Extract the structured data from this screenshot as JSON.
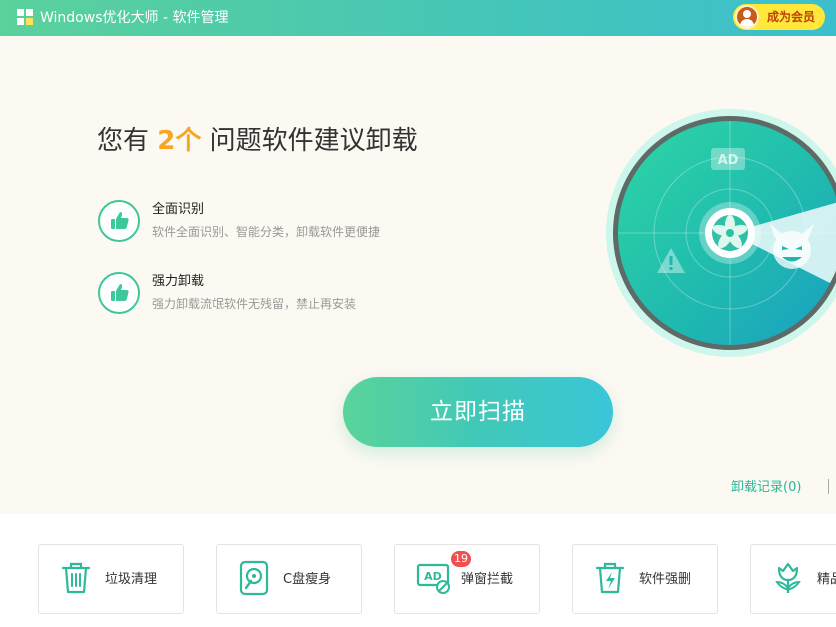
{
  "window": {
    "title": "Windows优化大师 - 软件管理"
  },
  "member_button": {
    "label": "成为会员"
  },
  "headline": {
    "prefix": "您有",
    "count": "2个",
    "suffix": "问题软件建议卸载"
  },
  "features": [
    {
      "title": "全面识别",
      "desc": "软件全面识别、智能分类，卸载软件更便捷",
      "icon": "thumbs-up-icon"
    },
    {
      "title": "强力卸载",
      "desc": "强力卸载流氓软件无残留，禁止再安装",
      "icon": "thumbs-up-icon"
    }
  ],
  "radar": {
    "ad_label": "AD"
  },
  "scan_button": {
    "label": "立即扫描"
  },
  "uninstall_history": {
    "label": "卸载记录(0)"
  },
  "tools": [
    {
      "label": "垃圾清理",
      "icon": "trash-icon"
    },
    {
      "label": "C盘瘦身",
      "icon": "disk-icon"
    },
    {
      "label": "弹窗拦截",
      "icon": "ad-block-icon",
      "badge": "19"
    },
    {
      "label": "软件强删",
      "icon": "force-delete-icon"
    },
    {
      "label": "精品",
      "icon": "tulip-icon"
    }
  ],
  "colors": {
    "accent": "#3dc89b",
    "highlight": "#f5a623",
    "member": "#ffe83a",
    "badge": "#f05050"
  }
}
